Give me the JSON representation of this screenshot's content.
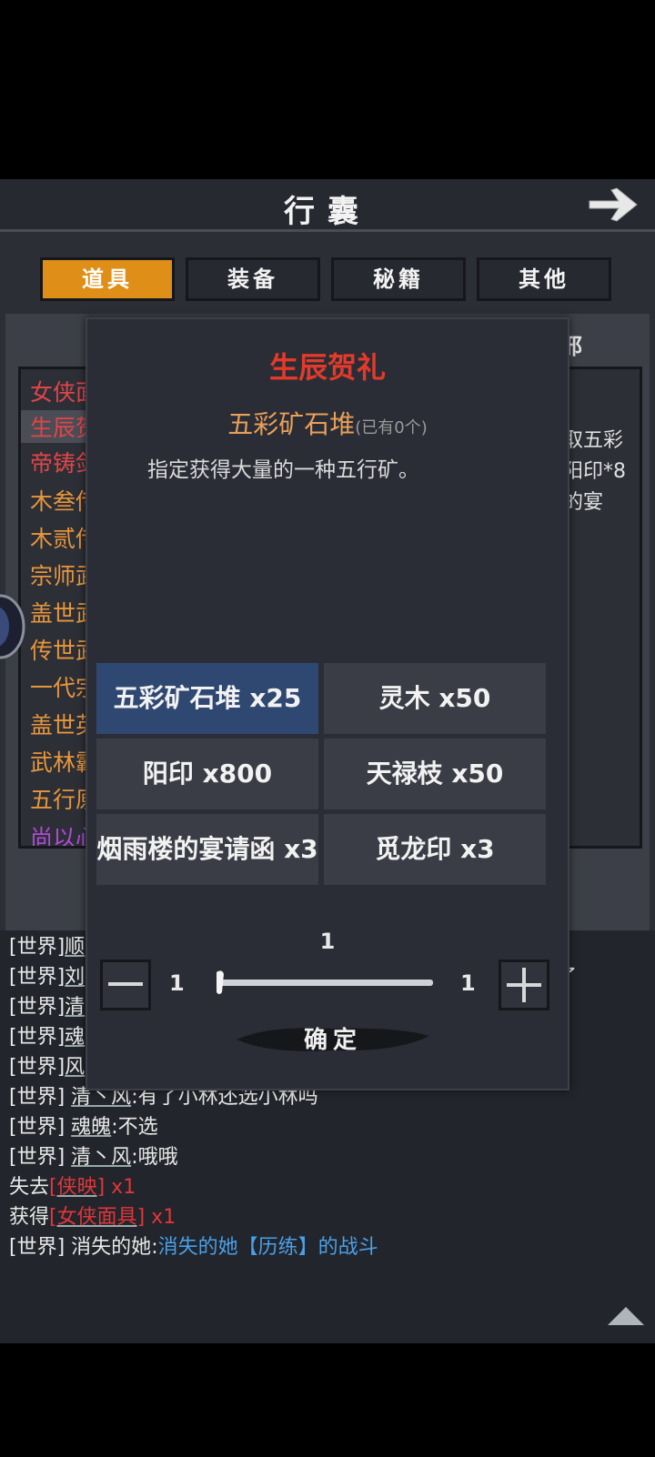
{
  "header": {
    "title": "行囊"
  },
  "tabs": [
    {
      "label": "道具",
      "active": true
    },
    {
      "label": "装备",
      "active": false
    },
    {
      "label": "秘籍",
      "active": false
    },
    {
      "label": "其他",
      "active": false
    }
  ],
  "bg_panel": {
    "header_fragment": "邪",
    "items": [
      {
        "text": "女侠面",
        "color": "#e0454a"
      },
      {
        "text": "生辰贺",
        "color": "#e0454a"
      },
      {
        "text": "帝铸剑",
        "color": "#e0454a"
      },
      {
        "text": "木叁传",
        "color": "#e8963c"
      },
      {
        "text": "木贰传",
        "color": "#e8963c"
      },
      {
        "text": "宗师武",
        "color": "#e8963c"
      },
      {
        "text": "盖世武",
        "color": "#e8963c"
      },
      {
        "text": "传世武",
        "color": "#e8963c"
      },
      {
        "text": "一代宗",
        "color": "#e8963c"
      },
      {
        "text": "盖世英",
        "color": "#e8963c"
      },
      {
        "text": "武林霸",
        "color": "#e8963c"
      },
      {
        "text": "五行原",
        "color": "#e8963c"
      },
      {
        "text": "尚以心",
        "color": "#b04ad8"
      }
    ],
    "right_fragments": [
      "取五彩",
      "阳印*8",
      "的宴"
    ]
  },
  "modal": {
    "title": "生辰贺礼",
    "item_name": "五彩矿石堆",
    "owned_text": "(已有0个)",
    "description": "指定获得大量的一种五行矿。",
    "options": [
      {
        "label": "五彩矿石堆 x25",
        "selected": true
      },
      {
        "label": "灵木 x50",
        "selected": false
      },
      {
        "label": "阳印 x800",
        "selected": false
      },
      {
        "label": "天禄枝 x50",
        "selected": false
      },
      {
        "label": "烟雨楼的宴请函 x3",
        "selected": false
      },
      {
        "label": "觅龙印 x3",
        "selected": false
      }
    ],
    "quantity": "1",
    "min": "1",
    "max": "1",
    "confirm_label": "确定"
  },
  "chat": {
    "lines": [
      {
        "prefix": "[世界]",
        "name": "顺",
        "text": ""
      },
      {
        "prefix": "[世界]",
        "name": "刘",
        "text": "",
        "tail": "了"
      },
      {
        "prefix": "[世界]",
        "name": "清",
        "text": ""
      },
      {
        "prefix": "[世界]",
        "name": "魂",
        "text": ""
      },
      {
        "prefix": "[世界]",
        "name": "风",
        "text": ""
      },
      {
        "prefix": "[世界]",
        "name": "清丶风",
        "text": ":有了小林还选小林吗"
      },
      {
        "prefix": "[世界]",
        "name": "魂魄",
        "text": ":不选"
      },
      {
        "prefix": "[世界]",
        "name": "清丶风",
        "text": ":哦哦"
      }
    ],
    "lost": {
      "label": "失去",
      "item": "[侠映]",
      "count": " x1"
    },
    "gained": {
      "label": "获得",
      "item": "[女侠面具]",
      "count": " x1"
    },
    "last": {
      "prefix": "[世界]",
      "name": "消失的她",
      "colon": ":",
      "link": "消失的她【历练】的战斗"
    }
  },
  "colors": {
    "accent_tab": "#df8f17",
    "selected_option": "#2f4872",
    "title_red": "#e33a2a"
  }
}
